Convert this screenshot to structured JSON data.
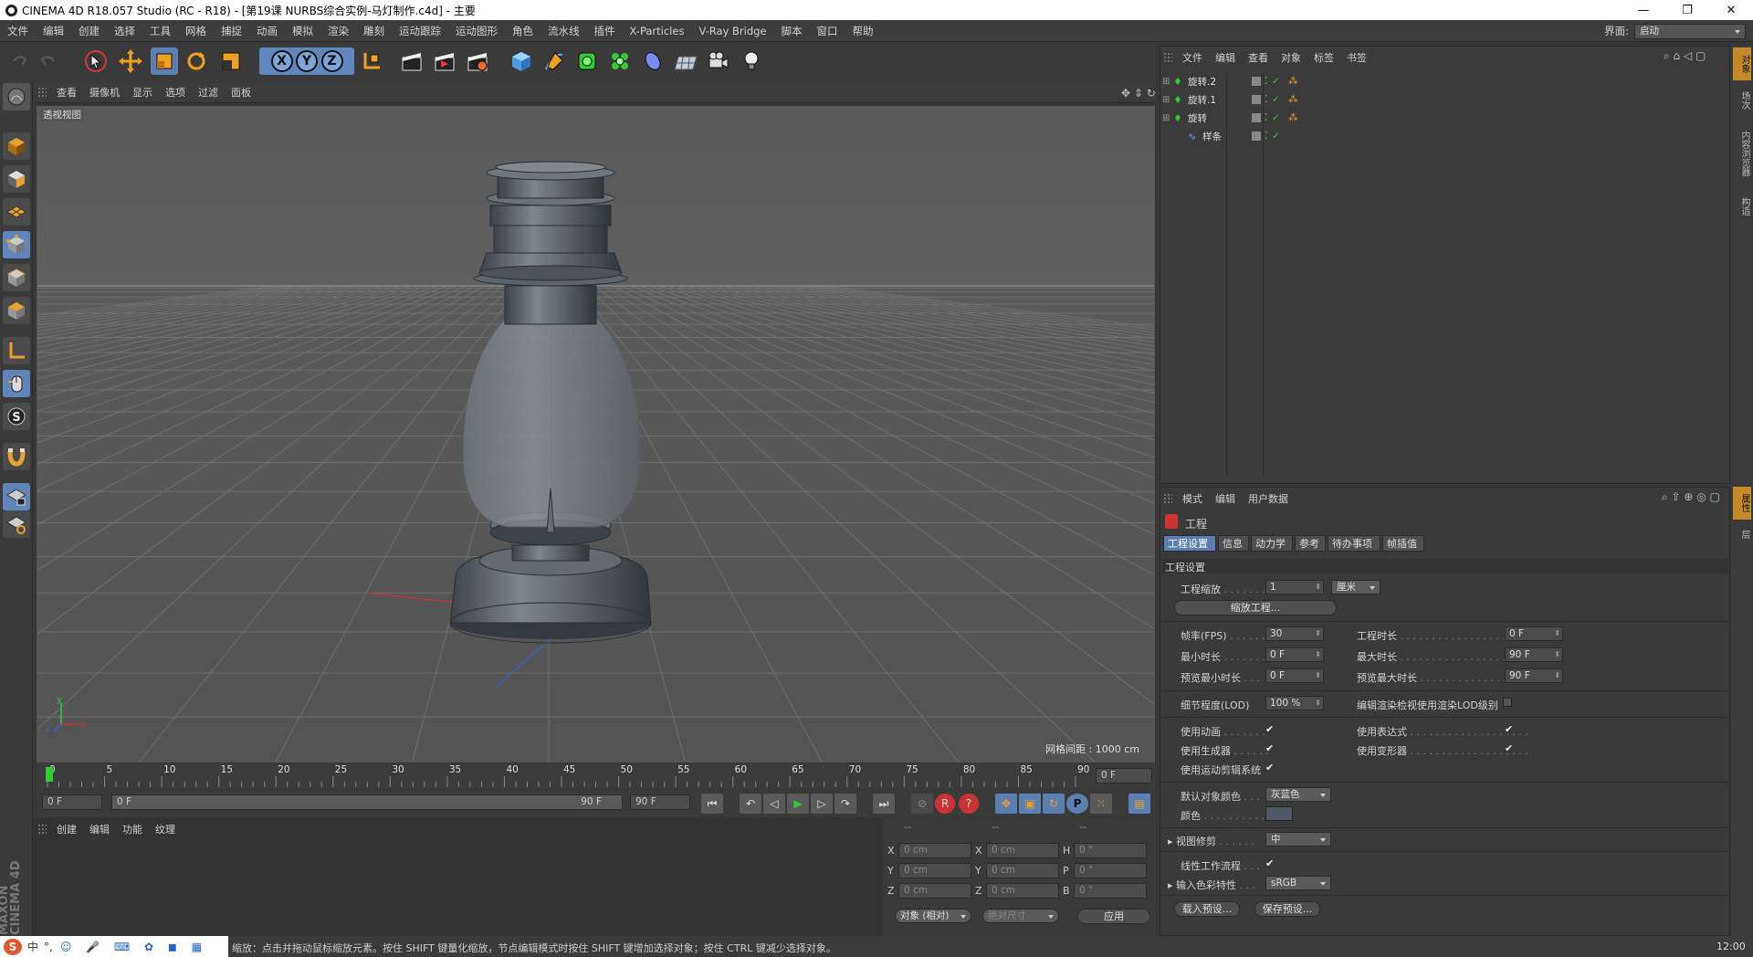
{
  "window": {
    "title": "CINEMA 4D R18.057 Studio (RC - R18) - [第19课  NURBS综合实例-马灯制作.c4d] - 主要",
    "min": "—",
    "max": "❐",
    "close": "✕"
  },
  "menubar": {
    "items": [
      "文件",
      "编辑",
      "创建",
      "选择",
      "工具",
      "网格",
      "捕捉",
      "动画",
      "模拟",
      "渲染",
      "雕刻",
      "运动跟踪",
      "运动图形",
      "角色",
      "流水线",
      "插件",
      "X-Particles",
      "V-Ray Bridge",
      "脚本",
      "窗口",
      "帮助"
    ],
    "layout_label": "界面:",
    "layout_value": "启动"
  },
  "toolbar": {
    "axis_x": "X",
    "axis_y": "Y",
    "axis_z": "Z"
  },
  "viewport": {
    "menu": [
      "查看",
      "摄像机",
      "显示",
      "选项",
      "过滤",
      "面板"
    ],
    "label": "透视视图",
    "grid_info": "网格间距 : 1000 cm",
    "axis_y": "y",
    "axis_z": "z",
    "axis_x": "x"
  },
  "timeline": {
    "ticks": [
      "0",
      "5",
      "10",
      "15",
      "20",
      "25",
      "30",
      "35",
      "40",
      "45",
      "50",
      "55",
      "60",
      "65",
      "70",
      "75",
      "80",
      "85",
      "90"
    ],
    "end_frame": "0 F",
    "current": 0
  },
  "anim": {
    "start": "0 F",
    "range_start": "0 F",
    "range_end": "90 F",
    "end": "90 F",
    "play_prev_key": "|◀",
    "rec": "R",
    "help": "?",
    "p": "P"
  },
  "material": {
    "menu": [
      "创建",
      "编辑",
      "功能",
      "纹理"
    ]
  },
  "coord": {
    "headers": [
      "--",
      "--",
      "--"
    ],
    "rows": [
      {
        "a": "X",
        "av": "0 cm",
        "b": "X",
        "bv": "0 cm",
        "c": "H",
        "cv": "0 °"
      },
      {
        "a": "Y",
        "av": "0 cm",
        "b": "Y",
        "bv": "0 cm",
        "c": "P",
        "cv": "0 °"
      },
      {
        "a": "Z",
        "av": "0 cm",
        "b": "Z",
        "bv": "0 cm",
        "c": "B",
        "cv": "0 °"
      }
    ],
    "mode": "对象 (相对)",
    "size": "绝对尺寸",
    "apply": "应用"
  },
  "objects": {
    "menu": [
      "文件",
      "编辑",
      "查看",
      "对象",
      "标签",
      "书签"
    ],
    "items": [
      {
        "name": "旋转.2"
      },
      {
        "name": "旋转.1"
      },
      {
        "name": "旋转"
      },
      {
        "name": "样条"
      }
    ]
  },
  "attributes": {
    "menu": [
      "模式",
      "编辑",
      "用户数据"
    ],
    "title": "工程",
    "tabs": [
      "工程设置",
      "信息",
      "动力学",
      "参考",
      "待办事项",
      "帧插值"
    ],
    "section": "工程设置",
    "scale_label": "工程缩放",
    "scale_value": "1",
    "scale_unit": "厘米",
    "scale_btn": "缩放工程...",
    "fps_label": "帧率(FPS)",
    "fps_value": "30",
    "duration_label": "工程时长",
    "duration_value": "0 F",
    "min_label": "最小时长",
    "min_value": "0 F",
    "max_label": "最大时长",
    "max_value": "90 F",
    "pmin_label": "预览最小时长",
    "pmin_value": "0 F",
    "pmax_label": "预览最大时长",
    "pmax_value": "90 F",
    "lod_label": "细节程度(LOD)",
    "lod_value": "100 %",
    "lod_render_label": "编辑渲染检视使用渲染LOD级别",
    "use_anim": "使用动画",
    "use_expr": "使用表达式",
    "use_gen": "使用生成器",
    "use_deform": "使用变形器",
    "use_motion": "使用运动剪辑系统",
    "default_color_label": "默认对象颜色",
    "default_color_value": "灰蓝色",
    "color_label": "颜色",
    "color_hex": "#4e5866",
    "clip_label": "视图修剪",
    "clip_value": "中",
    "linear_label": "线性工作流程",
    "profile_label": "输入色彩特性",
    "profile_value": "sRGB",
    "load_preset": "载入预设...",
    "save_preset": "保存预设...",
    "check": "✔"
  },
  "right_tabs": [
    "对象",
    "场次",
    "内容浏览器",
    "构造"
  ],
  "right_tabs2": [
    "属性",
    "层"
  ],
  "status": {
    "text": "缩放：点击并拖动鼠标缩放元素。按住 SHIFT 键量化缩放，节点编辑模式时按住 SHIFT 键增加选择对象；按住 CTRL 键减少选择对象。",
    "ime": "中",
    "ime2": "°,",
    "time": "12:00"
  },
  "colors": {
    "accent": "#5b7fb3",
    "orange": "#c48a2a"
  }
}
